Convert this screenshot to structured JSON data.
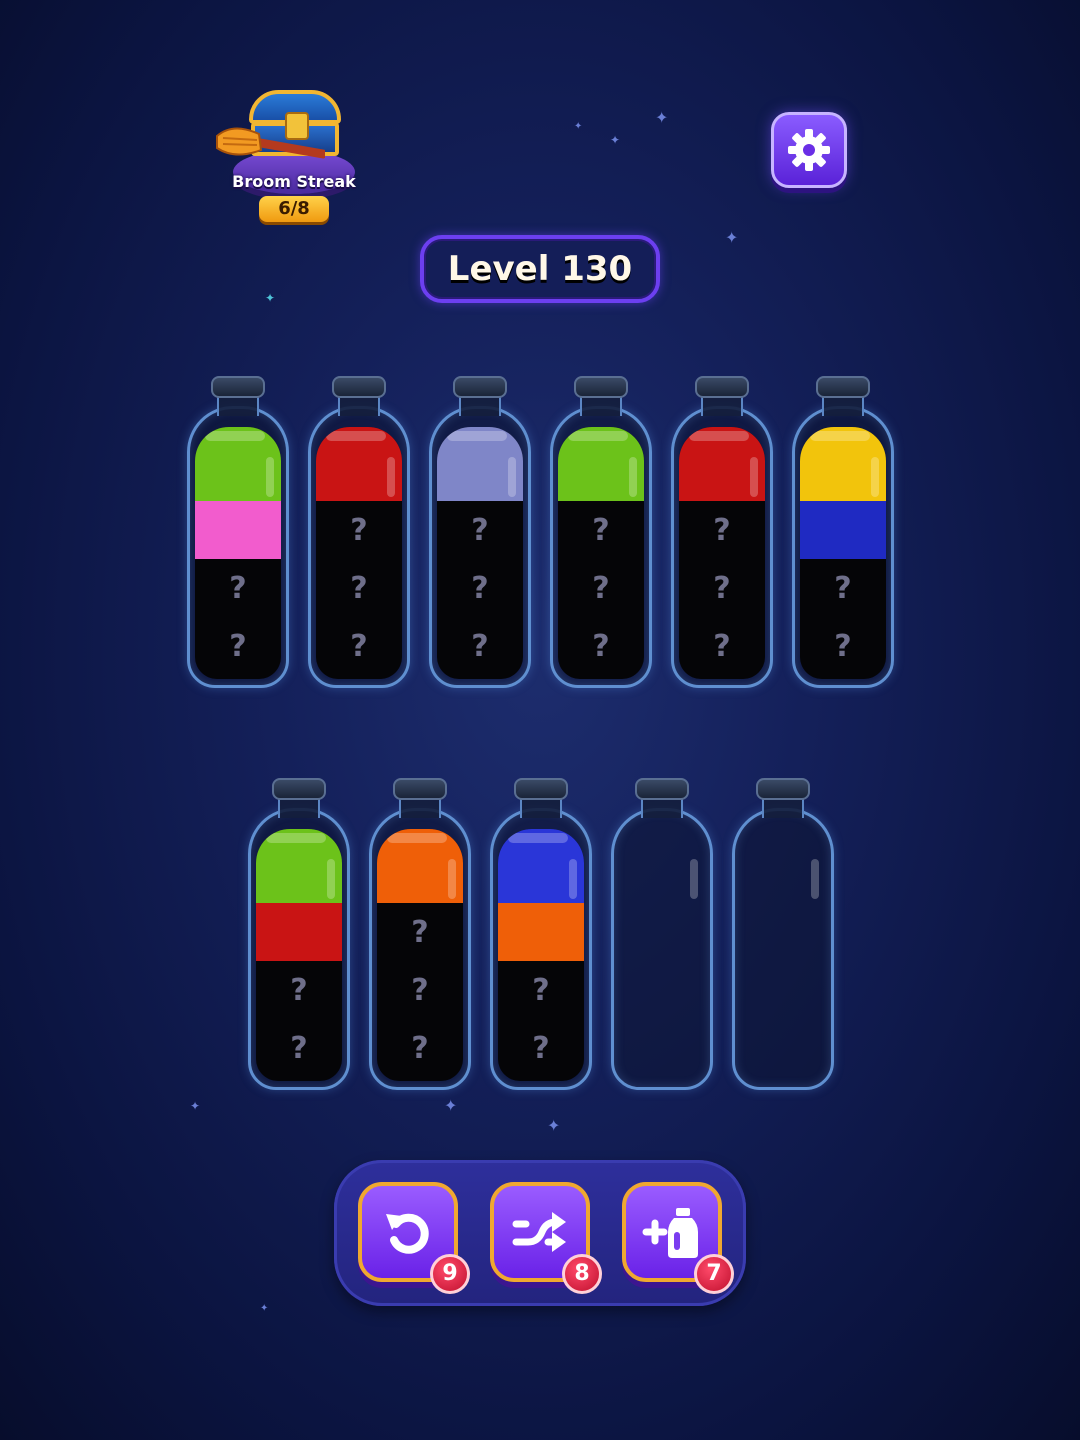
{
  "streak": {
    "label": "Broom Streak",
    "count": "6/8"
  },
  "level": {
    "label": "Level 130"
  },
  "icons": {
    "settings": "gear-icon",
    "undo": "undo-icon",
    "shuffle": "shuffle-icon",
    "add_bottle": "add-bottle-icon"
  },
  "colors": {
    "lime": "#6cc21a",
    "pink": "#f25ccd",
    "red": "#c91414",
    "lavender": "#7f86c8",
    "yellow": "#f2c40c",
    "blue": "#1f2ac2",
    "orange": "#ef5f08",
    "royal": "#2a36d8"
  },
  "hidden_mark": "?",
  "bottles": [
    {
      "layers": [
        "lime",
        "pink"
      ],
      "hidden": 2
    },
    {
      "layers": [
        "red"
      ],
      "hidden": 3
    },
    {
      "layers": [
        "lavender"
      ],
      "hidden": 3
    },
    {
      "layers": [
        "lime"
      ],
      "hidden": 3
    },
    {
      "layers": [
        "red"
      ],
      "hidden": 3
    },
    {
      "layers": [
        "yellow",
        "blue"
      ],
      "hidden": 2
    },
    {
      "layers": [
        "lime",
        "red"
      ],
      "hidden": 2
    },
    {
      "layers": [
        "orange"
      ],
      "hidden": 3
    },
    {
      "layers": [
        "royal",
        "orange"
      ],
      "hidden": 2
    },
    {
      "layers": [],
      "hidden": 0
    },
    {
      "layers": [],
      "hidden": 0
    }
  ],
  "toolbar": {
    "undo_count": "9",
    "shuffle_count": "8",
    "add_bottle_count": "7"
  }
}
